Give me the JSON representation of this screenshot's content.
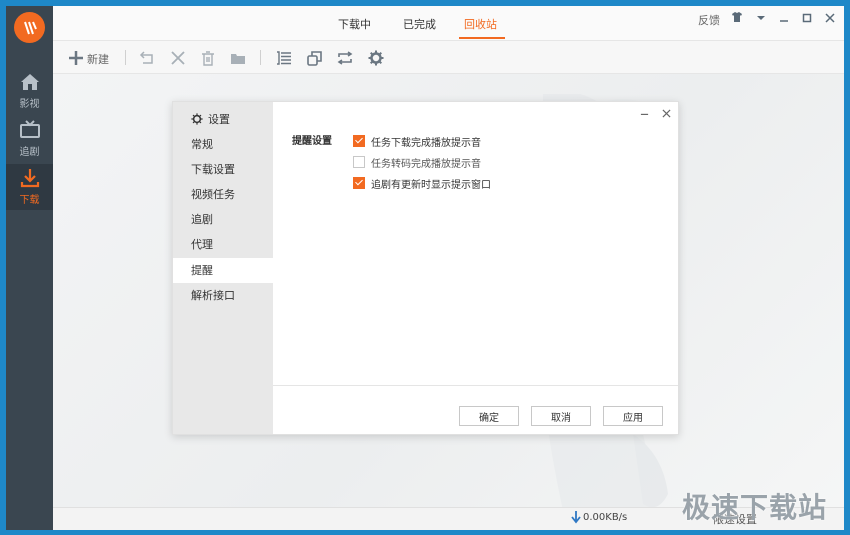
{
  "top_tabs": [
    {
      "label": "下载中"
    },
    {
      "label": "已完成"
    },
    {
      "label": "回收站"
    }
  ],
  "active_tab": "回收站",
  "feedback_label": "反馈",
  "sidebar": {
    "logo_icon": "logo-icon",
    "items": [
      {
        "label": "影视",
        "icon": "home-icon"
      },
      {
        "label": "追剧",
        "icon": "tv-icon"
      },
      {
        "label": "下载",
        "icon": "download-icon",
        "active": true
      }
    ]
  },
  "toolbar": {
    "new_label": "新建",
    "icons": [
      "undo-icon",
      "delete-x-icon",
      "trash-icon",
      "folder-icon",
      "list-icon",
      "copy-icon",
      "refresh-icon",
      "gear-icon"
    ]
  },
  "settings_dialog": {
    "title": "设置",
    "nav": [
      {
        "label": "常规"
      },
      {
        "label": "下载设置"
      },
      {
        "label": "视频任务"
      },
      {
        "label": "追剧"
      },
      {
        "label": "代理"
      },
      {
        "label": "提醒",
        "active": true
      },
      {
        "label": "解析接口"
      }
    ],
    "section_label": "提醒设置",
    "options": [
      {
        "label": "任务下载完成播放提示音",
        "checked": true
      },
      {
        "label": "任务转码完成播放提示音",
        "checked": false
      },
      {
        "label": "追剧有更新时显示提示窗口",
        "checked": true
      }
    ],
    "buttons": {
      "ok": "确定",
      "cancel": "取消",
      "apply": "应用"
    }
  },
  "status": {
    "speed": "0.00KB/s",
    "speed_setting": "限速设置"
  },
  "watermark": "极速下载站",
  "colors": {
    "accent": "#f26a21",
    "sidebar": "#3a4650",
    "window_border": "#1e88c8"
  }
}
